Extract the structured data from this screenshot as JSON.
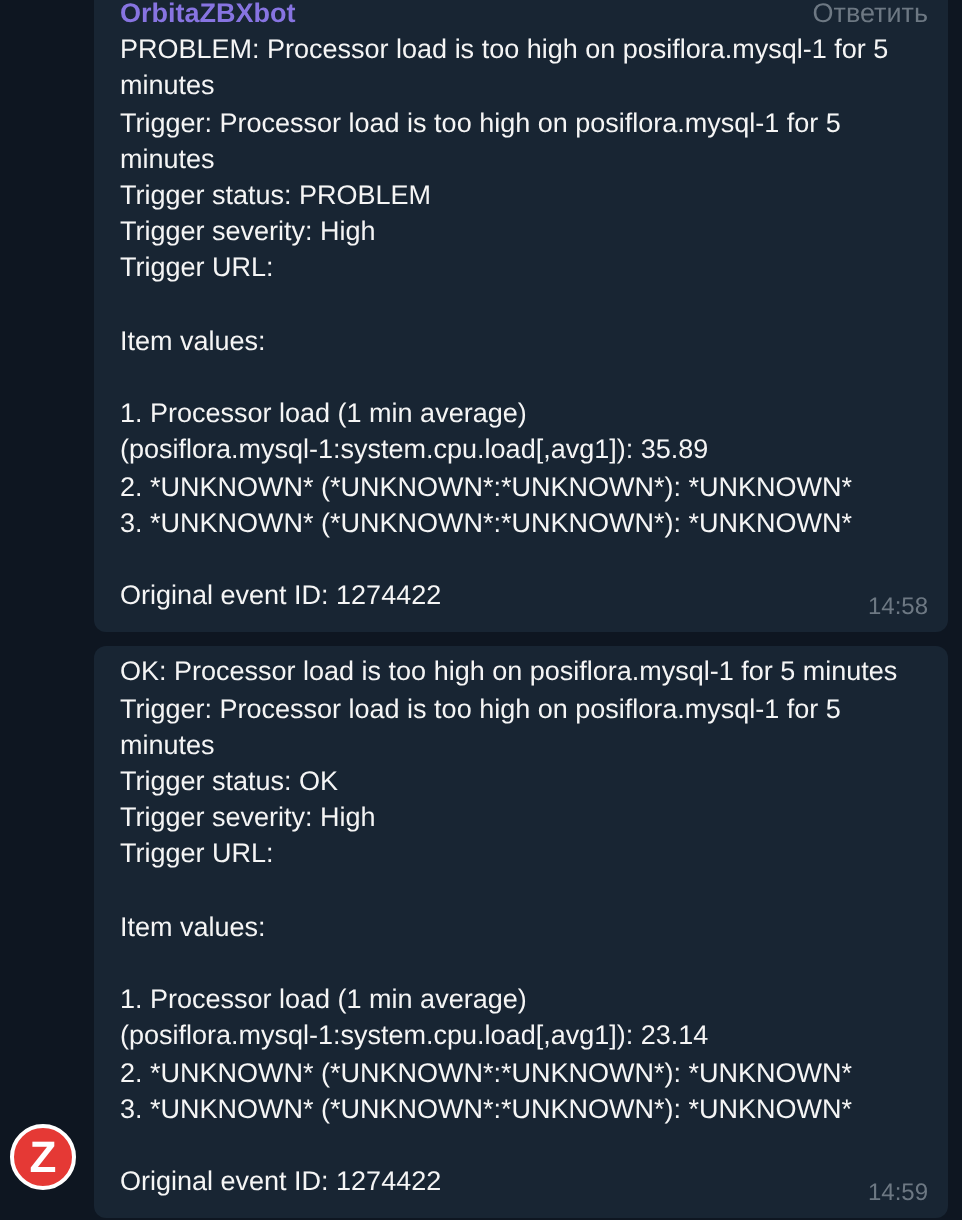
{
  "messages": [
    {
      "sender": "OrbitaZBXbot",
      "reply_action": "Ответить",
      "blocks": [
        [
          "PROBLEM: Processor load is too high on posiflora.mysql-1 for 5 minutes",
          "Trigger: Processor load is too high on posiflora.mysql-1 for 5 minutes",
          "Trigger status: PROBLEM",
          "Trigger severity: High",
          "Trigger URL:"
        ],
        [
          "Item values:"
        ],
        [
          "1. Processor load (1 min average)",
          "(posiflora.mysql-1:system.cpu.load[,avg1]): 35.89",
          "2. *UNKNOWN* (*UNKNOWN*:*UNKNOWN*): *UNKNOWN*",
          "3. *UNKNOWN* (*UNKNOWN*:*UNKNOWN*): *UNKNOWN*"
        ],
        [
          "Original event ID: 1274422"
        ]
      ],
      "time": "14:58"
    },
    {
      "blocks": [
        [
          "OK: Processor load is too high on posiflora.mysql-1 for 5 minutes",
          "Trigger: Processor load is too high on posiflora.mysql-1 for 5 minutes",
          "Trigger status: OK",
          "Trigger severity: High",
          "Trigger URL:"
        ],
        [
          "Item values:"
        ],
        [
          "1. Processor load (1 min average)",
          "(posiflora.mysql-1:system.cpu.load[,avg1]): 23.14",
          "2. *UNKNOWN* (*UNKNOWN*:*UNKNOWN*): *UNKNOWN*",
          "3. *UNKNOWN* (*UNKNOWN*:*UNKNOWN*): *UNKNOWN*"
        ],
        [
          "Original event ID: 1274422"
        ]
      ],
      "time": "14:59"
    }
  ],
  "avatar": {
    "letter": "Z"
  }
}
